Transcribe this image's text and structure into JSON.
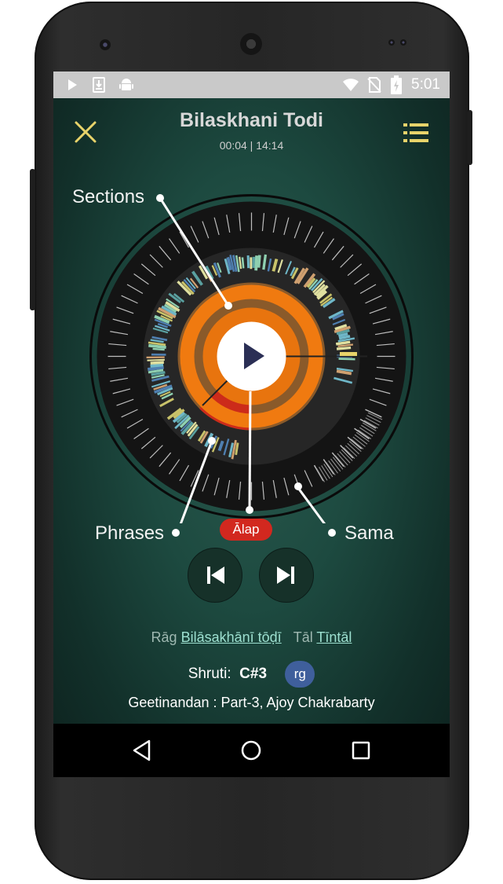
{
  "colors": {
    "accent": "#e8d36a",
    "orange": "#f07a10",
    "red": "#d2281f",
    "link": "#9de0d0",
    "shruti_badge": "#3f5f9c"
  },
  "status_bar": {
    "icons": [
      "play-icon",
      "download-icon",
      "android-icon",
      "wifi-icon",
      "no-sim-icon",
      "battery-charging-icon"
    ],
    "clock": "5:01"
  },
  "header": {
    "title": "Bilaskhani Todi",
    "time": "00:04 | 14:14",
    "close_icon": "close-icon",
    "menu_icon": "list-menu-icon"
  },
  "dial": {
    "callouts": {
      "sections": "Sections",
      "phrases": "Phrases",
      "sama": "Sama"
    },
    "current_section": "Ālap",
    "play_icon": "play-icon"
  },
  "controls": {
    "previous_icon": "skip-previous-icon",
    "next_icon": "skip-next-icon"
  },
  "info": {
    "rag_label": "Rāg",
    "rag_value": "Bilāsakhānī tōḍī",
    "tal_label": "Tāl",
    "tal_value": "Tīntāl",
    "shruti_label": "Shruti:",
    "shruti_value": "C#3",
    "shruti_badge": "rg",
    "artist": "Geetinandan : Part-3, Ajoy Chakrabarty"
  },
  "nav_bar": {
    "back_icon": "back-icon",
    "home_icon": "home-icon",
    "recents_icon": "recents-icon"
  }
}
